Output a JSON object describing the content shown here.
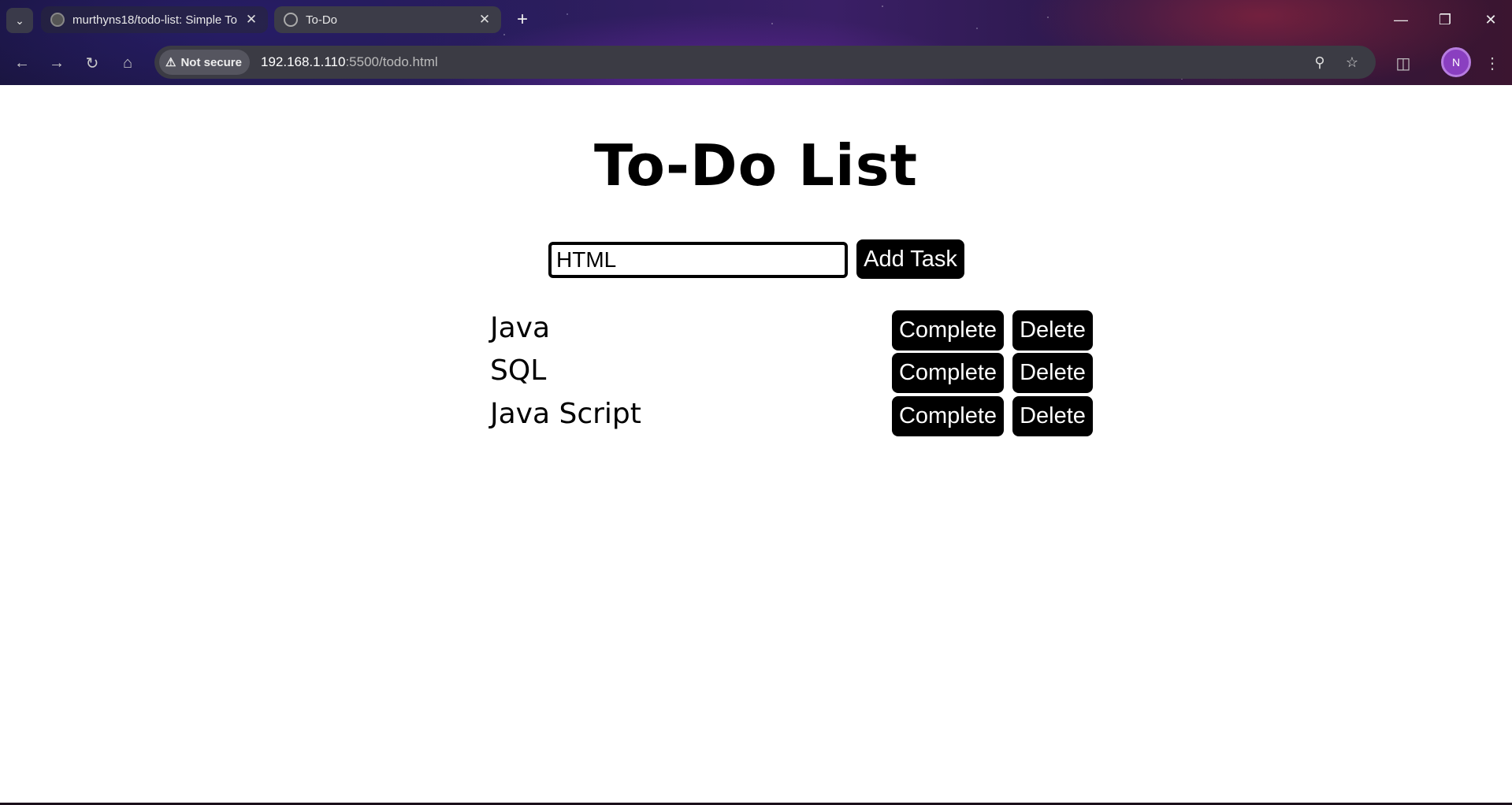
{
  "browser": {
    "tabs": [
      {
        "title": "murthyns18/todo-list: Simple To"
      },
      {
        "title": "To-Do"
      }
    ],
    "new_tab_label": "+",
    "security_label": "Not secure",
    "url_host": "192.168.1.110",
    "url_rest": ":5500/todo.html",
    "profile_initial": "N",
    "icons": [
      "tab-search-icon",
      "github-icon",
      "globe-icon",
      "close-icon",
      "back-icon",
      "forward-icon",
      "reload-icon",
      "home-icon",
      "warning-icon",
      "zoom-icon",
      "bookmark-star-icon",
      "extensions-icon",
      "menu-icon",
      "minimize-icon",
      "restore-icon"
    ]
  },
  "app": {
    "title": "To-Do List",
    "input_value": "HTML",
    "add_button_label": "Add Task",
    "tasks": [
      {
        "text": "Java",
        "complete_label": "Complete",
        "delete_label": "Delete"
      },
      {
        "text": "SQL",
        "complete_label": "Complete",
        "delete_label": "Delete"
      },
      {
        "text": "Java Script",
        "complete_label": "Complete",
        "delete_label": "Delete"
      }
    ]
  }
}
